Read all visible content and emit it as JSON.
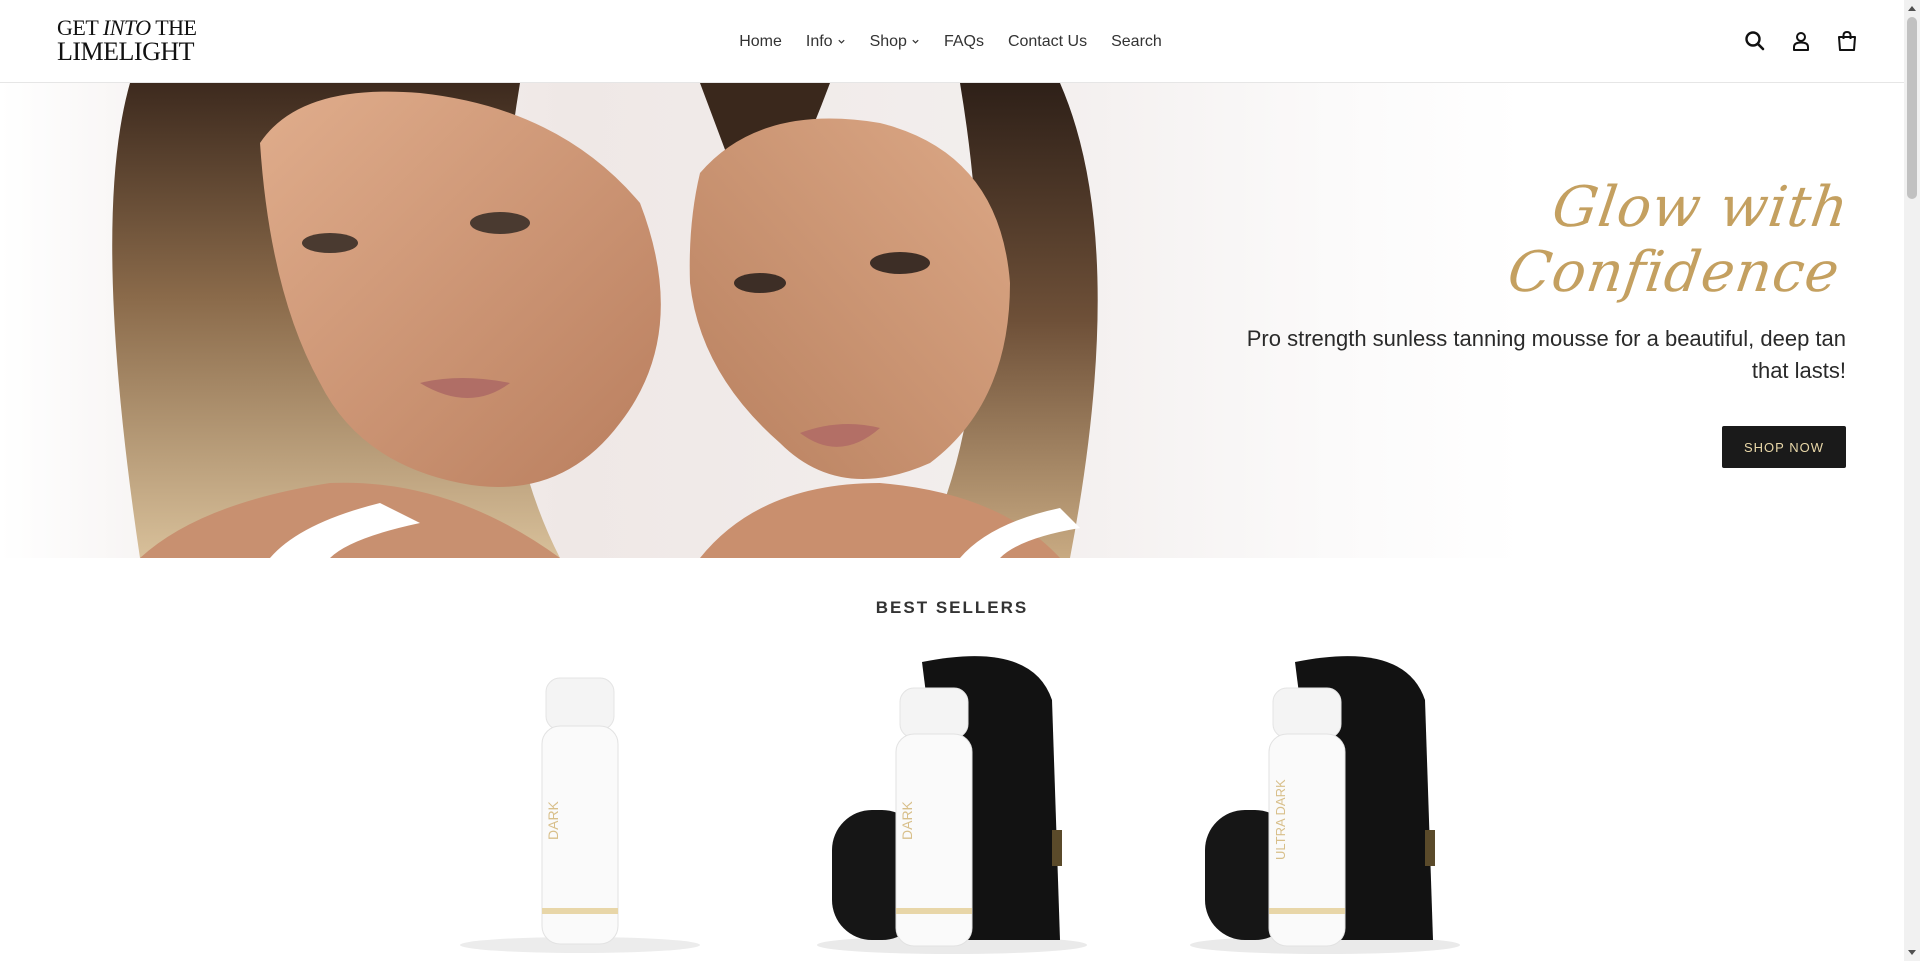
{
  "logo": {
    "line1_a": "GET ",
    "line1_b": "INTO",
    "line1_c": " THE",
    "line2": "LIMELIGHT"
  },
  "nav": {
    "items": [
      {
        "label": "Home",
        "dropdown": false
      },
      {
        "label": "Info",
        "dropdown": true
      },
      {
        "label": "Shop",
        "dropdown": true
      },
      {
        "label": "FAQs",
        "dropdown": false
      },
      {
        "label": "Contact Us",
        "dropdown": false
      },
      {
        "label": "Search",
        "dropdown": false
      }
    ]
  },
  "header_icons": [
    "search-icon",
    "account-icon",
    "cart-icon"
  ],
  "hero": {
    "tagline": "Glow with Confidence",
    "subtitle": "Pro strength sunless tanning mousse for a beautiful, deep tan that lasts!",
    "button": "SHOP NOW"
  },
  "best_sellers": {
    "title": "BEST SELLERS",
    "products": [
      {
        "shade": "DARK",
        "mitt": false
      },
      {
        "shade": "DARK",
        "mitt": true
      },
      {
        "shade": "ULTRA DARK",
        "mitt": true
      }
    ]
  },
  "colors": {
    "accent_gold": "#c4a060",
    "button_bg": "#1a1a1a",
    "button_text": "#e8d7a8"
  }
}
